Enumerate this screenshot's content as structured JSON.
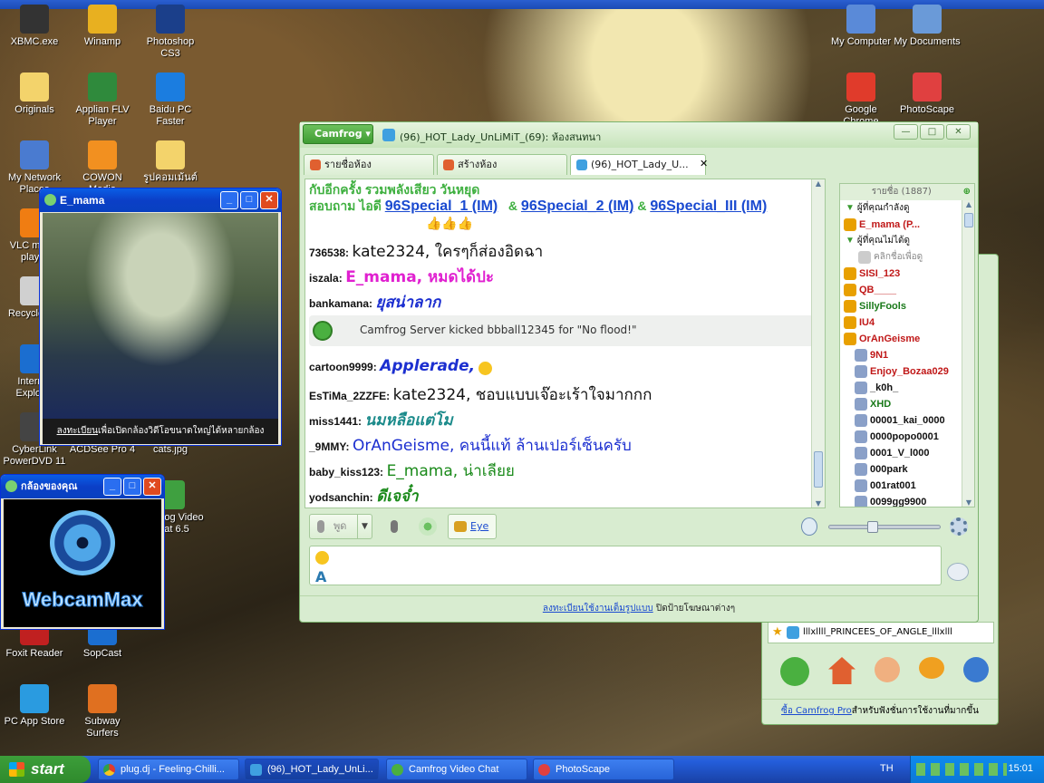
{
  "desktop": {
    "icons": [
      {
        "label": "XBMC.exe",
        "color": "#333"
      },
      {
        "label": "Winamp",
        "color": "#e8b020"
      },
      {
        "label": "Photoshop CS3",
        "color": "#1b3f8a"
      },
      {
        "label": "Originals",
        "color": "#f3d36b"
      },
      {
        "label": "Applian FLV Player",
        "color": "#2f8a3c"
      },
      {
        "label": "Baidu PC Faster",
        "color": "#1b7de0"
      },
      {
        "label": "My Network Places",
        "color": "#4a7bd0"
      },
      {
        "label": "COWON Media",
        "color": "#f29020"
      },
      {
        "label": "รูปคอมเม้นต์",
        "color": "#f3d36b"
      },
      {
        "label": "VLC media player",
        "color": "#f07d12"
      },
      {
        "label": "Recycle Bin",
        "color": "#d0d0d0"
      },
      {
        "label": "Internet Explorer",
        "color": "#1b6ed0"
      },
      {
        "label": "CyberLink PowerDVD 11",
        "color": "#444"
      },
      {
        "label": "ACDSee Pro 4",
        "color": "#777"
      },
      {
        "label": "cats.jpg",
        "color": "#888"
      },
      {
        "label": "Camfrog Video Chat 6.5",
        "color": "#3fa040"
      },
      {
        "label": "Foxit Reader",
        "color": "#c02020"
      },
      {
        "label": "SopCast",
        "color": "#1b6ed0"
      },
      {
        "label": "PC App Store",
        "color": "#2a9be0"
      },
      {
        "label": "Subway Surfers",
        "color": "#e07020"
      },
      {
        "label": "My Computer",
        "color": "#5a8ad8"
      },
      {
        "label": "My Documents",
        "color": "#6a9ad8"
      },
      {
        "label": "Google Chrome",
        "color": "#e03b2b"
      },
      {
        "label": "PhotoScape",
        "color": "#e04040"
      }
    ]
  },
  "video_window": {
    "title": "E_mama",
    "footer_link": "ลงทะเบียน",
    "footer_text": "เพื่อเปิดกล้องวิดีโอขนาดใหญ่ได้หลายกล้อง"
  },
  "cam_window": {
    "title": "กล้องของคุณ",
    "logo": "WebcamMax"
  },
  "camfrog": {
    "menu_label": "Camfrog ▾",
    "title": "(96)_HOT_Lady_UnLiMiT_(69): ห้องสนทนา",
    "tabs": [
      {
        "label": "รายชื่อห้อง"
      },
      {
        "label": "สร้างห้อง"
      },
      {
        "label": "(96)_HOT_Lady_U..."
      }
    ],
    "topic_line1": "กับอีกครั้ง รวมพลังเสียว วันหยุด",
    "topic_line2": "สอบถาม ไอดี",
    "link1": "96Special_1 (IM)",
    "amp": "&",
    "link2": "96Special_2 (IM)",
    "link3": "96Special_III (IM)",
    "messages": [
      {
        "nick": "736538:",
        "text": "kate2324, ใครๆก็ส่องอิดฉา",
        "color": "#111",
        "bold": false,
        "italic": false
      },
      {
        "nick": "iszala:",
        "text": "E_mama, หมดได้ปะ",
        "color": "#e020d0",
        "bold": true,
        "italic": false
      },
      {
        "nick": "bankamana:",
        "text": "ยุสน่าลาก",
        "color": "#1c2fd0",
        "bold": true,
        "italic": true
      },
      {
        "nick": "cartoon9999:",
        "text": "Applerade,",
        "color": "#1c2fd0",
        "bold": true,
        "italic": true
      },
      {
        "nick": "EsTiMa_2ZZFE:",
        "text": "kate2324, ชอบแบบเจ๊อะเร้าใจมากกก",
        "color": "#111",
        "bold": false,
        "italic": false
      },
      {
        "nick": "miss1441:",
        "text": "นมหลือแต่โม",
        "color": "#1a8a8a",
        "bold": true,
        "italic": true
      },
      {
        "nick": "_9MMY:",
        "text": "OrAnGeisme, คนนี้แท้ ล้านเปอร์เซ็นครับ",
        "color": "#1c2fd0",
        "bold": false,
        "italic": false
      },
      {
        "nick": "baby_kiss123:",
        "text": "E_mama, น่าเลียย",
        "color": "#1a8a1a",
        "bold": false,
        "italic": false
      },
      {
        "nick": "yodsanchin:",
        "text": "ดีเจจ๋ำ",
        "color": "#1a8a1a",
        "bold": true,
        "italic": true
      }
    ],
    "system_msg": "Camfrog Server kicked bbball12345 for \"No flood!\"",
    "userlist_header": "รายชื่อ (1887)",
    "group1": "ผู้ที่คุณกำลังดู",
    "group2": "ผู้ที่คุณไม่ได้ดู",
    "click_hint": "คลิกชื่อเพื่อดู",
    "users": [
      {
        "name": "E_mama (P...",
        "color": "#c01818"
      },
      {
        "name": "SISI_123",
        "color": "#c01818"
      },
      {
        "name": "QB____",
        "color": "#c01818"
      },
      {
        "name": "SillyFools",
        "color": "#1a7a1a"
      },
      {
        "name": "IU4",
        "color": "#c01818"
      },
      {
        "name": "OrAnGeisme",
        "color": "#c01818"
      },
      {
        "name": "9N1",
        "color": "#c01818"
      },
      {
        "name": "Enjoy_Bozaa029",
        "color": "#c01818"
      },
      {
        "name": "_k0h_",
        "color": "#111"
      },
      {
        "name": "XHD",
        "color": "#1a7a1a"
      },
      {
        "name": "00001_kai_0000",
        "color": "#111"
      },
      {
        "name": "0000popo0001",
        "color": "#111"
      },
      {
        "name": "0001_V_l000",
        "color": "#111"
      },
      {
        "name": "000park",
        "color": "#111"
      },
      {
        "name": "001rat001",
        "color": "#111"
      },
      {
        "name": "0099gg9900",
        "color": "#111"
      }
    ],
    "talk_label": "พูด",
    "eye_label": "Eye",
    "ad_link": "ลงทะเบียนใช้งานเต็มรูปแบบ",
    "ad_text": "ปิดป้ายโฆษณาต่างๆ"
  },
  "side_window": {
    "room_name": "lllxllll_PRINCEES_OF_ANGLE_lllxlll",
    "pro_link": "ซื้อ Camfrog Pro",
    "pro_text": "สำหรับฟังชั่นการใช้งานที่มากขึ้น"
  },
  "taskbar": {
    "start": "start",
    "tasks": [
      "plug.dj - Feeling-Chilli...",
      "(96)_HOT_Lady_UnLi...",
      "Camfrog Video Chat",
      "PhotoScape"
    ],
    "lang": "TH",
    "time": "15:01"
  }
}
